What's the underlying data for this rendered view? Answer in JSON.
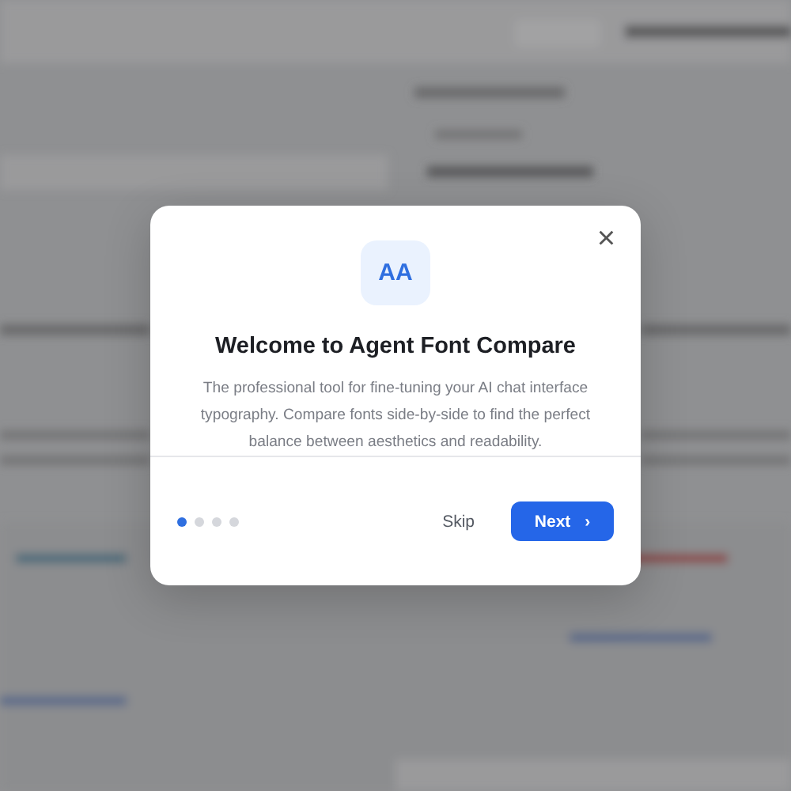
{
  "dialog": {
    "icon_text": "AA",
    "title": "Welcome to Agent Font Compare",
    "description": "The professional tool for fine-tuning your AI chat interface typography. Compare fonts side-by-side to find the perfect balance between aesthetics and readability.",
    "steps": [
      {
        "selected": true
      },
      {
        "selected": false
      },
      {
        "selected": false
      },
      {
        "selected": false
      }
    ],
    "skip": "Skip",
    "next": "Next",
    "next_icon": "›",
    "close": "×"
  }
}
